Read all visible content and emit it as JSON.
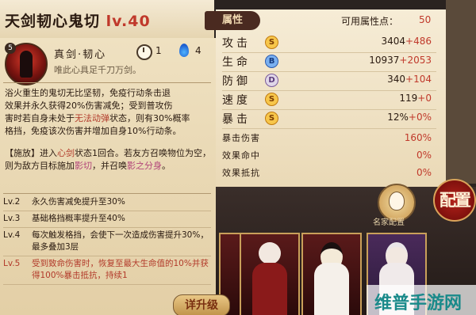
{
  "character": {
    "name": "天剑韧心鬼切",
    "level_prefix": "lv.",
    "level": "40"
  },
  "skill": {
    "badge": "5",
    "name": "真剑·韧心",
    "subtitle": "唯此心具足千刀万剑。",
    "cooldown_icon": "clock-icon",
    "cooldown": "1",
    "cost_icon": "soul-fire-icon",
    "cost": "4",
    "desc_lines": [
      "浴火重生的鬼切无比坚韧，免疫行动条击退",
      "效果并永久获得20%伤害减免；受到普攻伤",
      "害时若自身未处于",
      "无法动弹",
      "状态，则有30%概率",
      "格挡，免疫该次伤害并增加自身10%行动条。"
    ],
    "desc2_parts": [
      "【施放】进入",
      "心剑",
      "状态1回合。若友方召唤",
      "物位为空，则为敌方目标施加",
      "影切",
      "，并召唤",
      "影之分身",
      "。"
    ],
    "levels": [
      {
        "lv": "Lv.2",
        "text": "永久伤害减免提升至30%"
      },
      {
        "lv": "Lv.3",
        "text": "基础格挡概率提升至40%"
      },
      {
        "lv": "Lv.4",
        "text": "每次触发格挡，会使下一次造成伤害提升30%，最多叠加3层"
      },
      {
        "lv": "Lv.5",
        "text": "受到致命伤害时，恢复至最大生命值的10%并获得100%暴击抵抗，持续1"
      }
    ]
  },
  "stats": {
    "tab": "属性",
    "points_label": "可用属性点：",
    "points": "50",
    "rows": [
      {
        "name": "攻击",
        "grade": "S",
        "base": "3404",
        "add": "+486"
      },
      {
        "name": "生命",
        "grade": "B",
        "base": "10937",
        "add": "+2053"
      },
      {
        "name": "防御",
        "grade": "D",
        "base": "340",
        "add": "+104"
      },
      {
        "name": "速度",
        "grade": "S",
        "base": "119",
        "add": "+0"
      },
      {
        "name": "暴击",
        "grade": "S",
        "base": "12%",
        "add": "+0%"
      }
    ],
    "extra": [
      {
        "name": "暴击伤害",
        "value": "160%"
      },
      {
        "name": "效果命中",
        "value": "0%"
      },
      {
        "name": "效果抵抗",
        "value": "0%"
      }
    ]
  },
  "controls": {
    "mask_label": "名家配置",
    "config_label": "配置",
    "upgrade_label": "详升级"
  },
  "watermark": "维普手游网"
}
